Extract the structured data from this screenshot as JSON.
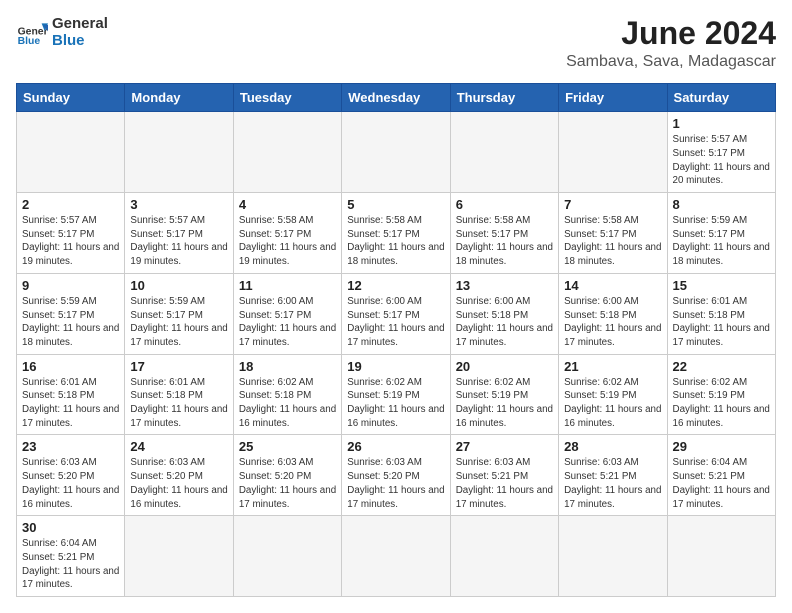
{
  "header": {
    "logo_general": "General",
    "logo_blue": "Blue",
    "month_title": "June 2024",
    "location": "Sambava, Sava, Madagascar"
  },
  "weekdays": [
    "Sunday",
    "Monday",
    "Tuesday",
    "Wednesday",
    "Thursday",
    "Friday",
    "Saturday"
  ],
  "weeks": [
    [
      {
        "day": "",
        "info": ""
      },
      {
        "day": "",
        "info": ""
      },
      {
        "day": "",
        "info": ""
      },
      {
        "day": "",
        "info": ""
      },
      {
        "day": "",
        "info": ""
      },
      {
        "day": "",
        "info": ""
      },
      {
        "day": "1",
        "info": "Sunrise: 5:57 AM\nSunset: 5:17 PM\nDaylight: 11 hours\nand 20 minutes."
      }
    ],
    [
      {
        "day": "2",
        "info": "Sunrise: 5:57 AM\nSunset: 5:17 PM\nDaylight: 11 hours\nand 19 minutes."
      },
      {
        "day": "3",
        "info": "Sunrise: 5:57 AM\nSunset: 5:17 PM\nDaylight: 11 hours\nand 19 minutes."
      },
      {
        "day": "4",
        "info": "Sunrise: 5:58 AM\nSunset: 5:17 PM\nDaylight: 11 hours\nand 19 minutes."
      },
      {
        "day": "5",
        "info": "Sunrise: 5:58 AM\nSunset: 5:17 PM\nDaylight: 11 hours\nand 18 minutes."
      },
      {
        "day": "6",
        "info": "Sunrise: 5:58 AM\nSunset: 5:17 PM\nDaylight: 11 hours\nand 18 minutes."
      },
      {
        "day": "7",
        "info": "Sunrise: 5:58 AM\nSunset: 5:17 PM\nDaylight: 11 hours\nand 18 minutes."
      },
      {
        "day": "8",
        "info": "Sunrise: 5:59 AM\nSunset: 5:17 PM\nDaylight: 11 hours\nand 18 minutes."
      }
    ],
    [
      {
        "day": "9",
        "info": "Sunrise: 5:59 AM\nSunset: 5:17 PM\nDaylight: 11 hours\nand 18 minutes."
      },
      {
        "day": "10",
        "info": "Sunrise: 5:59 AM\nSunset: 5:17 PM\nDaylight: 11 hours\nand 17 minutes."
      },
      {
        "day": "11",
        "info": "Sunrise: 6:00 AM\nSunset: 5:17 PM\nDaylight: 11 hours\nand 17 minutes."
      },
      {
        "day": "12",
        "info": "Sunrise: 6:00 AM\nSunset: 5:17 PM\nDaylight: 11 hours\nand 17 minutes."
      },
      {
        "day": "13",
        "info": "Sunrise: 6:00 AM\nSunset: 5:18 PM\nDaylight: 11 hours\nand 17 minutes."
      },
      {
        "day": "14",
        "info": "Sunrise: 6:00 AM\nSunset: 5:18 PM\nDaylight: 11 hours\nand 17 minutes."
      },
      {
        "day": "15",
        "info": "Sunrise: 6:01 AM\nSunset: 5:18 PM\nDaylight: 11 hours\nand 17 minutes."
      }
    ],
    [
      {
        "day": "16",
        "info": "Sunrise: 6:01 AM\nSunset: 5:18 PM\nDaylight: 11 hours\nand 17 minutes."
      },
      {
        "day": "17",
        "info": "Sunrise: 6:01 AM\nSunset: 5:18 PM\nDaylight: 11 hours\nand 17 minutes."
      },
      {
        "day": "18",
        "info": "Sunrise: 6:02 AM\nSunset: 5:18 PM\nDaylight: 11 hours\nand 16 minutes."
      },
      {
        "day": "19",
        "info": "Sunrise: 6:02 AM\nSunset: 5:19 PM\nDaylight: 11 hours\nand 16 minutes."
      },
      {
        "day": "20",
        "info": "Sunrise: 6:02 AM\nSunset: 5:19 PM\nDaylight: 11 hours\nand 16 minutes."
      },
      {
        "day": "21",
        "info": "Sunrise: 6:02 AM\nSunset: 5:19 PM\nDaylight: 11 hours\nand 16 minutes."
      },
      {
        "day": "22",
        "info": "Sunrise: 6:02 AM\nSunset: 5:19 PM\nDaylight: 11 hours\nand 16 minutes."
      }
    ],
    [
      {
        "day": "23",
        "info": "Sunrise: 6:03 AM\nSunset: 5:20 PM\nDaylight: 11 hours\nand 16 minutes."
      },
      {
        "day": "24",
        "info": "Sunrise: 6:03 AM\nSunset: 5:20 PM\nDaylight: 11 hours\nand 16 minutes."
      },
      {
        "day": "25",
        "info": "Sunrise: 6:03 AM\nSunset: 5:20 PM\nDaylight: 11 hours\nand 17 minutes."
      },
      {
        "day": "26",
        "info": "Sunrise: 6:03 AM\nSunset: 5:20 PM\nDaylight: 11 hours\nand 17 minutes."
      },
      {
        "day": "27",
        "info": "Sunrise: 6:03 AM\nSunset: 5:21 PM\nDaylight: 11 hours\nand 17 minutes."
      },
      {
        "day": "28",
        "info": "Sunrise: 6:03 AM\nSunset: 5:21 PM\nDaylight: 11 hours\nand 17 minutes."
      },
      {
        "day": "29",
        "info": "Sunrise: 6:04 AM\nSunset: 5:21 PM\nDaylight: 11 hours\nand 17 minutes."
      }
    ],
    [
      {
        "day": "30",
        "info": "Sunrise: 6:04 AM\nSunset: 5:21 PM\nDaylight: 11 hours\nand 17 minutes."
      },
      {
        "day": "",
        "info": ""
      },
      {
        "day": "",
        "info": ""
      },
      {
        "day": "",
        "info": ""
      },
      {
        "day": "",
        "info": ""
      },
      {
        "day": "",
        "info": ""
      },
      {
        "day": "",
        "info": ""
      }
    ]
  ]
}
